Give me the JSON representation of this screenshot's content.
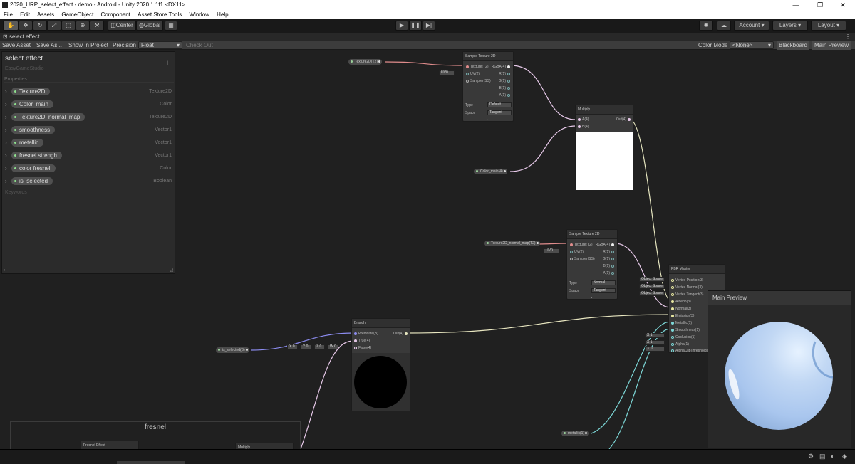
{
  "window": {
    "title": "2020_URP_select_effect - demo - Android - Unity 2020.1.1f1 <DX11>",
    "minimize": "—",
    "restore": "❐",
    "close": "✕"
  },
  "menu": [
    "File",
    "Edit",
    "Assets",
    "GameObject",
    "Component",
    "Asset Store Tools",
    "Window",
    "Help"
  ],
  "toolbar": {
    "center_label": "Center",
    "global_label": "Global",
    "account_label": "Account",
    "layers_label": "Layers",
    "layout_label": "Layout"
  },
  "tab": {
    "label": "select effect"
  },
  "graph_toolbar": {
    "save_asset": "Save Asset",
    "save_as": "Save As...",
    "show_in_project": "Show In Project",
    "precision_label": "Precision",
    "precision_value": "Float",
    "check_out": "Check Out",
    "color_mode_label": "Color Mode",
    "color_mode_value": "<None>",
    "blackboard": "Blackboard",
    "main_preview": "Main Preview"
  },
  "blackboard": {
    "title": "select effect",
    "subtitle": "EasyGameStudio",
    "plus": "+",
    "properties_header": "Properties",
    "keywords_header": "Keywords",
    "properties": [
      {
        "name": "Texture2D",
        "type": "Texture2D"
      },
      {
        "name": "Color_main",
        "type": "Color"
      },
      {
        "name": "Texture2D_normal_map",
        "type": "Texture2D"
      },
      {
        "name": "smoothness",
        "type": "Vector1"
      },
      {
        "name": "metallic",
        "type": "Vector1"
      },
      {
        "name": "fresnel strengh",
        "type": "Vector1"
      },
      {
        "name": "color fresnel",
        "type": "Color"
      },
      {
        "name": "is_selected",
        "type": "Boolean"
      }
    ]
  },
  "nodes": {
    "sample1": {
      "title": "Sample Texture 2D",
      "in_texture": "Texture(T2)",
      "in_uv": "UV(2)",
      "in_sampler": "Sampler(SS)",
      "out_rgba": "RGBA(4)",
      "out_r": "R(1)",
      "out_g": "G(1)",
      "out_b": "B(1)",
      "out_a": "A(1)",
      "type_label": "Type",
      "type_value": "Default",
      "space_label": "Space",
      "space_value": "Tangent",
      "uv_value": "UV0"
    },
    "multiply": {
      "title": "Multiply",
      "in_a": "A(4)",
      "in_b": "B(4)",
      "out": "Out(4)"
    },
    "sample2": {
      "title": "Sample Texture 2D",
      "in_texture": "Texture(T2)",
      "in_uv": "UV(2)",
      "in_sampler": "Sampler(SS)",
      "out_rgba": "RGBA(4)",
      "out_r": "R(1)",
      "out_g": "G(1)",
      "out_b": "B(1)",
      "out_a": "A(1)",
      "type_label": "Type",
      "type_value": "Normal",
      "space_label": "Space",
      "space_value": "Tangent",
      "uv_value": "UV0"
    },
    "pbr": {
      "title": "PBR Master",
      "ports": [
        "Vertex Position(3)",
        "Vertex Normal(3)",
        "Vertex Tangent(3)",
        "Albedo(3)",
        "Normal(3)",
        "Emission(3)",
        "Metallic(1)",
        "Smoothness(1)",
        "Occlusion(1)",
        "Alpha(1)",
        "AlphaClipThreshold(1)"
      ],
      "object_space": "Object Space"
    },
    "branch": {
      "title": "Branch",
      "in_pred": "Predicate(B)",
      "in_true": "True(4)",
      "in_false": "False(4)",
      "out": "Out(4)",
      "vec": [
        "X 0",
        "Y 0",
        "Z 0",
        "W 0"
      ]
    },
    "fresnel_group": {
      "title": "fresnel"
    },
    "fresnel_effect": {
      "title": "Fresnel Effect"
    },
    "multiply2": {
      "title": "Multiply"
    }
  },
  "pills": {
    "texture2d": "Texture2D(T2)",
    "color_main": "Color_main(4)",
    "normal_map": "Texture2D_normal_map(T2)",
    "is_selected": "is_selected(B)",
    "metallic": "metallic(1)"
  },
  "inline_values": {
    "x1": "X 1",
    "x0": "X 0",
    "x05": "X 0.5"
  },
  "preview": {
    "title": "Main Preview"
  },
  "colors": {
    "wire_texture": "#e08c8c",
    "wire_vector": "#e6c8e8",
    "wire_float": "#7dd8d8",
    "wire_bool": "#8c8cf0",
    "wire_emission": "#e8e6c0"
  }
}
